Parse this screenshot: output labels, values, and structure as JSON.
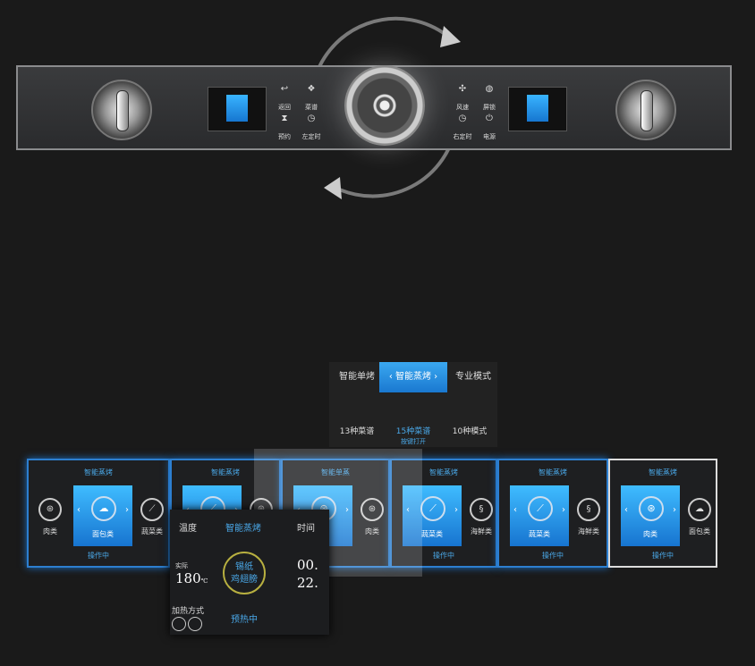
{
  "panel": {
    "left_buttons": [
      {
        "icon": "return-icon",
        "glyph": "↩",
        "label": "返回"
      },
      {
        "icon": "recipe-icon",
        "glyph": "❖",
        "label": "菜谱"
      },
      {
        "icon": "hourglass-icon",
        "glyph": "⧗",
        "label": "预约"
      },
      {
        "icon": "timer-icon",
        "glyph": "◷",
        "label": "左定时"
      }
    ],
    "right_buttons": [
      {
        "icon": "fan-icon",
        "glyph": "✣",
        "label": "风速"
      },
      {
        "icon": "lock-icon",
        "glyph": "◍",
        "label": "屏锁"
      },
      {
        "icon": "timer-icon",
        "glyph": "◷",
        "label": "右定时"
      },
      {
        "icon": "power-icon",
        "glyph": "⏻",
        "label": "电源"
      }
    ]
  },
  "modes": {
    "tabs": [
      "智能单烤",
      "智能蒸烤",
      "专业模式"
    ],
    "subs": [
      "13种菜谱",
      "15种菜谱",
      "10种模式"
    ],
    "sub_hint": "按键打开"
  },
  "cards": [
    {
      "title": "智能蒸烤",
      "left": "肉类",
      "left_glyph": "⊛",
      "main": "面包类",
      "main_glyph": "☁",
      "right": "蔬菜类",
      "right_glyph": "⟋",
      "status": "操作中"
    },
    {
      "title": "智能蒸烤",
      "left": "",
      "left_glyph": "",
      "main": "",
      "main_glyph": "⟋",
      "right": "",
      "right_glyph": "⊛",
      "status": ""
    },
    {
      "title": "智能单蒸",
      "left": "",
      "left_glyph": "",
      "main": "",
      "main_glyph": "⊛",
      "right": "肉类",
      "right_glyph": "⊛",
      "status": ""
    },
    {
      "title": "智能蒸烤",
      "left": "",
      "left_glyph": "",
      "main": "蔬菜类",
      "main_glyph": "⟋",
      "right": "海鲜类",
      "right_glyph": "§",
      "status": "操作中"
    },
    {
      "title": "智能蒸烤",
      "left": "",
      "left_glyph": "",
      "main": "蔬菜类",
      "main_glyph": "⟋",
      "right": "海鲜类",
      "right_glyph": "§",
      "status": "操作中"
    },
    {
      "title": "智能蒸烤",
      "left": "",
      "left_glyph": "",
      "main": "肉类",
      "main_glyph": "⊛",
      "right": "面包类",
      "right_glyph": "☁",
      "status": "操作中"
    }
  ],
  "popup": {
    "temp_label": "温度",
    "mode": "智能蒸烤",
    "time_label": "时间",
    "actual": "实际",
    "temp": "180",
    "temp_unit": "℃",
    "dish_1": "锡纸",
    "dish_2": "鸡翅膀",
    "time_h": "00.",
    "time_m": "22.",
    "heat_label": "加热方式",
    "status": "预热中"
  },
  "colors": {
    "accent": "#2d9ae8",
    "ring": "#b8b040"
  }
}
